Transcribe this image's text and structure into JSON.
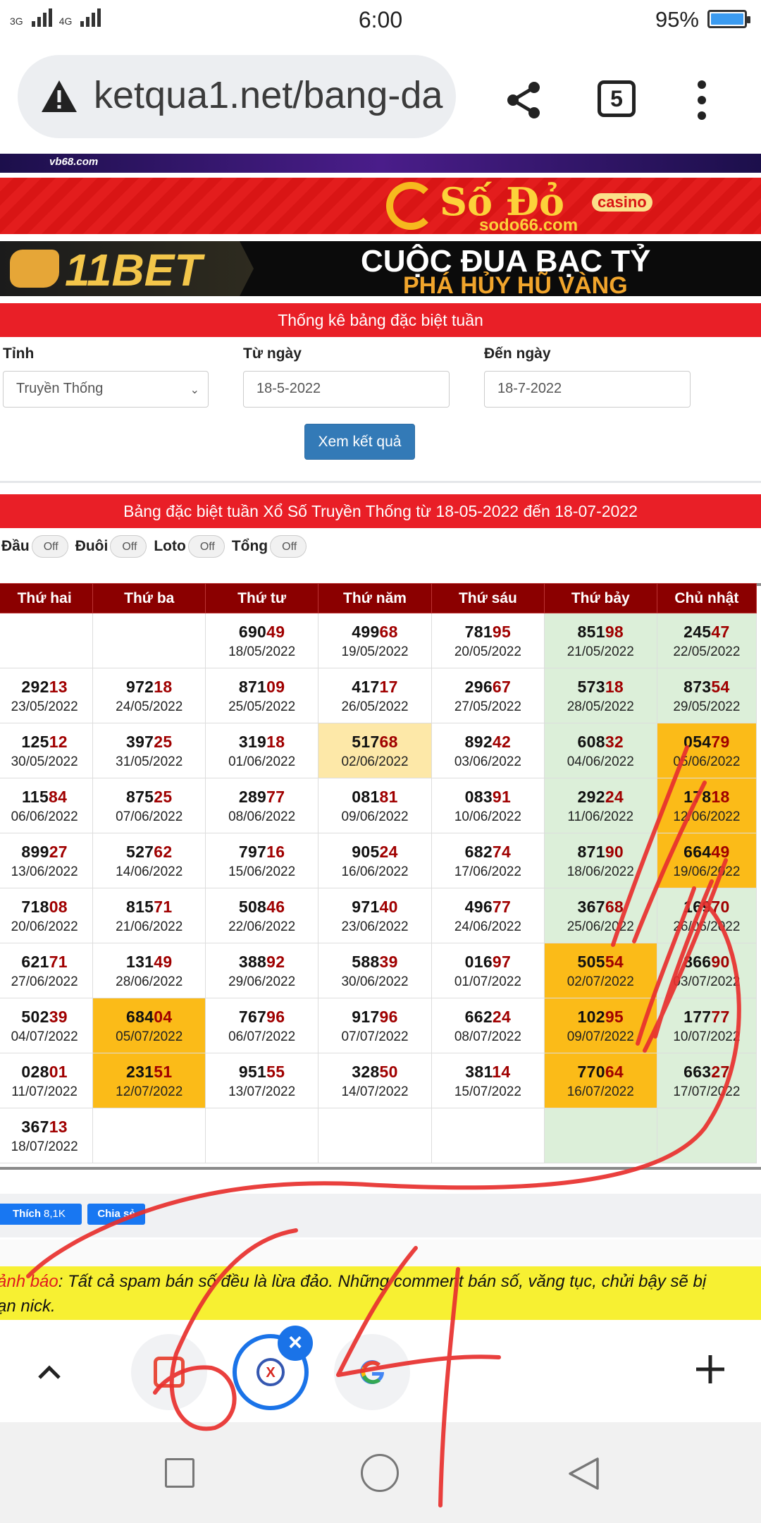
{
  "status_bar": {
    "network_1": "3G",
    "network_2": "4G",
    "time": "6:00",
    "battery": "95%"
  },
  "browser": {
    "url": "ketqua1.net/bang-da",
    "tab_count": "5",
    "icons": [
      "warning-icon",
      "share-icon",
      "tabs-icon",
      "menu-icon"
    ]
  },
  "banners": {
    "top_strip": "vb68.com",
    "sodo": {
      "name": "Số Đỏ",
      "badge": "casino",
      "url": "sodo66.com"
    },
    "bet": {
      "name": "11BET",
      "line1": "CUỘC ĐUA BẠC TỶ",
      "line2": "PHÁ HỦY HŨ VÀNG"
    }
  },
  "form": {
    "title": "Thống kê bảng đặc biệt tuần",
    "province_label": "Tỉnh",
    "province_value": "Truyền Thống",
    "from_label": "Từ ngày",
    "from_value": "18-5-2022",
    "to_label": "Đến ngày",
    "to_value": "18-7-2022",
    "submit": "Xem kết quả"
  },
  "results": {
    "title": "Bảng đặc biệt tuần Xổ Số Truyền Thống từ 18-05-2022 đến 18-07-2022",
    "toggles": [
      {
        "label": "Đầu",
        "state": "Off"
      },
      {
        "label": "Đuôi",
        "state": "Off"
      },
      {
        "label": "Loto",
        "state": "Off"
      },
      {
        "label": "Tổng",
        "state": "Off"
      }
    ],
    "headers": [
      "Thứ hai",
      "Thứ ba",
      "Thứ tư",
      "Thứ năm",
      "Thứ sáu",
      "Thứ bảy",
      "Chủ nhật"
    ]
  },
  "table_rows": [
    [
      null,
      null,
      [
        "690",
        "49",
        "18/05/2022",
        ""
      ],
      [
        "499",
        "68",
        "19/05/2022",
        ""
      ],
      [
        "781",
        "95",
        "20/05/2022",
        ""
      ],
      [
        "851",
        "98",
        "21/05/2022",
        "g"
      ],
      [
        "245",
        "47",
        "22/05/2022",
        "g"
      ]
    ],
    [
      [
        "292",
        "13",
        "23/05/2022",
        ""
      ],
      [
        "972",
        "18",
        "24/05/2022",
        ""
      ],
      [
        "871",
        "09",
        "25/05/2022",
        ""
      ],
      [
        "417",
        "17",
        "26/05/2022",
        ""
      ],
      [
        "296",
        "67",
        "27/05/2022",
        ""
      ],
      [
        "573",
        "18",
        "28/05/2022",
        "g"
      ],
      [
        "873",
        "54",
        "29/05/2022",
        "g"
      ]
    ],
    [
      [
        "125",
        "12",
        "30/05/2022",
        ""
      ],
      [
        "397",
        "25",
        "31/05/2022",
        ""
      ],
      [
        "319",
        "18",
        "01/06/2022",
        ""
      ],
      [
        "517",
        "68",
        "02/06/2022",
        "y"
      ],
      [
        "892",
        "42",
        "03/06/2022",
        ""
      ],
      [
        "608",
        "32",
        "04/06/2022",
        "g"
      ],
      [
        "054",
        "79",
        "05/06/2022",
        "o"
      ]
    ],
    [
      [
        "115",
        "84",
        "06/06/2022",
        ""
      ],
      [
        "875",
        "25",
        "07/06/2022",
        ""
      ],
      [
        "289",
        "77",
        "08/06/2022",
        ""
      ],
      [
        "081",
        "81",
        "09/06/2022",
        ""
      ],
      [
        "083",
        "91",
        "10/06/2022",
        ""
      ],
      [
        "292",
        "24",
        "11/06/2022",
        "g"
      ],
      [
        "178",
        "18",
        "12/06/2022",
        "o"
      ]
    ],
    [
      [
        "899",
        "27",
        "13/06/2022",
        ""
      ],
      [
        "527",
        "62",
        "14/06/2022",
        ""
      ],
      [
        "797",
        "16",
        "15/06/2022",
        ""
      ],
      [
        "905",
        "24",
        "16/06/2022",
        ""
      ],
      [
        "682",
        "74",
        "17/06/2022",
        ""
      ],
      [
        "871",
        "90",
        "18/06/2022",
        "g"
      ],
      [
        "664",
        "49",
        "19/06/2022",
        "o"
      ]
    ],
    [
      [
        "718",
        "08",
        "20/06/2022",
        ""
      ],
      [
        "815",
        "71",
        "21/06/2022",
        ""
      ],
      [
        "508",
        "46",
        "22/06/2022",
        ""
      ],
      [
        "971",
        "40",
        "23/06/2022",
        ""
      ],
      [
        "496",
        "77",
        "24/06/2022",
        ""
      ],
      [
        "367",
        "68",
        "25/06/2022",
        "g"
      ],
      [
        "169",
        "70",
        "26/06/2022",
        "g"
      ]
    ],
    [
      [
        "621",
        "71",
        "27/06/2022",
        ""
      ],
      [
        "131",
        "49",
        "28/06/2022",
        ""
      ],
      [
        "388",
        "92",
        "29/06/2022",
        ""
      ],
      [
        "588",
        "39",
        "30/06/2022",
        ""
      ],
      [
        "016",
        "97",
        "01/07/2022",
        ""
      ],
      [
        "505",
        "54",
        "02/07/2022",
        "o"
      ],
      [
        "866",
        "90",
        "03/07/2022",
        "g"
      ]
    ],
    [
      [
        "502",
        "39",
        "04/07/2022",
        ""
      ],
      [
        "684",
        "04",
        "05/07/2022",
        "o"
      ],
      [
        "767",
        "96",
        "06/07/2022",
        ""
      ],
      [
        "917",
        "96",
        "07/07/2022",
        ""
      ],
      [
        "662",
        "24",
        "08/07/2022",
        ""
      ],
      [
        "102",
        "95",
        "09/07/2022",
        "o"
      ],
      [
        "177",
        "77",
        "10/07/2022",
        "g"
      ]
    ],
    [
      [
        "028",
        "01",
        "11/07/2022",
        ""
      ],
      [
        "231",
        "51",
        "12/07/2022",
        "o"
      ],
      [
        "951",
        "55",
        "13/07/2022",
        ""
      ],
      [
        "328",
        "50",
        "14/07/2022",
        ""
      ],
      [
        "381",
        "14",
        "15/07/2022",
        ""
      ],
      [
        "770",
        "64",
        "16/07/2022",
        "o"
      ],
      [
        "663",
        "27",
        "17/07/2022",
        "g"
      ]
    ],
    [
      [
        "367",
        "13",
        "18/07/2022",
        ""
      ],
      null,
      null,
      null,
      null,
      "g",
      "g"
    ]
  ],
  "social": {
    "like_label": "Thích",
    "like_count": "8,1K",
    "share_label": "Chia sẻ"
  },
  "warning": {
    "lead": "ảnh báo",
    "text": ": Tất cả spam bán số đều là lừa đảo. Những comment bán số, văng tục, chửi bậy sẽ bị",
    "text2": "ạn nick."
  },
  "colors": {
    "brand_red": "#e91f27",
    "header_dark_red": "#8b0000",
    "highlight_orange": "#fbbb18",
    "highlight_green": "#dcefd9",
    "highlight_yellow": "#fde8a8",
    "button_blue": "#337ab7",
    "scribble_red": "#e8302e"
  }
}
